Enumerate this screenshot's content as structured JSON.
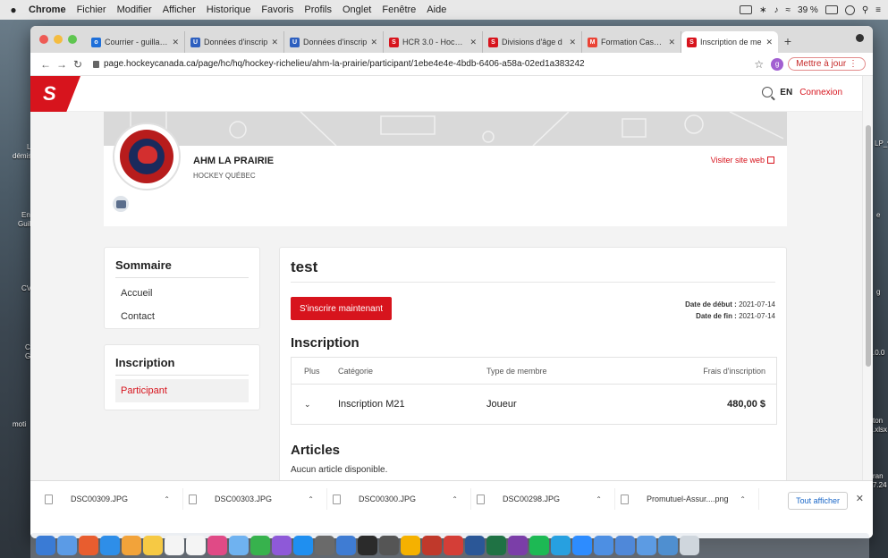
{
  "menubar": {
    "app": "Chrome",
    "items": [
      "Fichier",
      "Modifier",
      "Afficher",
      "Historique",
      "Favoris",
      "Profils",
      "Onglet",
      "Fenêtre",
      "Aide"
    ],
    "battery": "39 %"
  },
  "desktop_labels": [
    "L",
    "démis",
    "En",
    "Guil",
    "CV",
    "C",
    "G",
    "moti",
    "LP_v",
    "e",
    "g",
    ".0.0",
    "ton",
    ".xlsx",
    "ran",
    "7.24"
  ],
  "tabs": [
    {
      "title": "Courrier - guillaum",
      "favicon_color": "#1e6fd9",
      "favicon_letter": "o"
    },
    {
      "title": "Données d'inscrip",
      "favicon_color": "#2d5fbf",
      "favicon_letter": "U"
    },
    {
      "title": "Données d'inscrip",
      "favicon_color": "#2d5fbf",
      "favicon_letter": "U"
    },
    {
      "title": "HCR 3.0 - Hockey",
      "favicon_color": "#d7141d",
      "favicon_letter": "S"
    },
    {
      "title": "Divisions d'âge d",
      "favicon_color": "#d7141d",
      "favicon_letter": "S"
    },
    {
      "title": "Formation Cascad",
      "favicon_color": "#ea4335",
      "favicon_letter": "M"
    },
    {
      "title": "Inscription de me",
      "favicon_color": "#d7141d",
      "favicon_letter": "S",
      "active": true
    }
  ],
  "toolbar": {
    "url": "page.hockeycanada.ca/page/hc/hq/hockey-richelieu/ahm-la-prairie/participant/1ebe4e4e-4bdb-6406-a58a-02ed1a383242",
    "profile_initial": "g",
    "update_label": "Mettre à jour"
  },
  "site_header": {
    "logo_text": "S",
    "lang": "EN",
    "login": "Connexion"
  },
  "org": {
    "name": "AHM LA PRAIRIE",
    "federation": "HOCKEY QUÉBEC",
    "visit_label": "Visiter site web"
  },
  "sidebar": {
    "summary_title": "Sommaire",
    "summary_items": [
      "Accueil",
      "Contact"
    ],
    "registration_title": "Inscription",
    "registration_items": [
      "Participant"
    ]
  },
  "main": {
    "title": "test",
    "register_button": "S'inscrire maintenant",
    "start_label": "Date de début :",
    "start_date": "2021-07-14",
    "end_label": "Date de fin :",
    "end_date": "2021-07-14",
    "registration_title": "Inscription",
    "table": {
      "headers": [
        "Plus",
        "Catégorie",
        "Type de membre",
        "Frais d'inscription"
      ],
      "rows": [
        {
          "category": "Inscription M21",
          "member_type": "Joueur",
          "fee": "480,00 $"
        }
      ]
    },
    "articles_title": "Articles",
    "articles_empty": "Aucun article disponible."
  },
  "downloads": {
    "items": [
      "DSC00309.JPG",
      "DSC00303.JPG",
      "DSC00300.JPG",
      "DSC00298.JPG",
      "Promutuel-Assur....png"
    ],
    "show_all": "Tout afficher"
  },
  "dock_colors": [
    "#3a7bd5",
    "#5b9be6",
    "#e85d2f",
    "#2e8ee8",
    "#f2a33a",
    "#f6c944",
    "#f4f4f4",
    "#f4f4f4",
    "#e04a86",
    "#6fb2f0",
    "#37b24d",
    "#8e59d8",
    "#1f8ff0",
    "#6a6a6a",
    "#3f7cd3",
    "#2b2b2b",
    "#555555",
    "#f5b100",
    "#c0392b",
    "#d43e37",
    "#2b5797",
    "#1f7244",
    "#7b3ea8",
    "#1db954",
    "#27a0e0",
    "#2d8cff",
    "#4d8fe3",
    "#4f88d9",
    "#5c9be3",
    "#4f8fd0",
    "#cfd6dd"
  ]
}
